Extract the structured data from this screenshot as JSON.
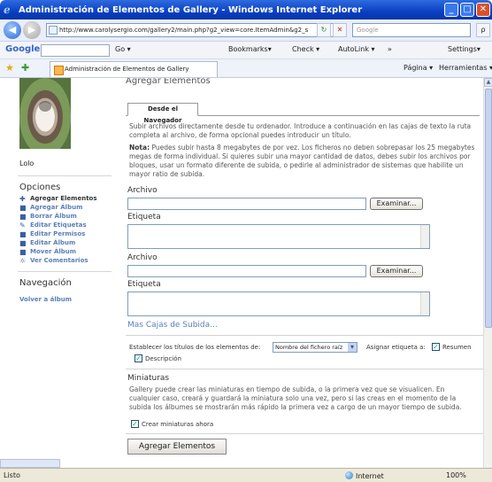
{
  "window": {
    "title": "Administración de Elementos de Gallery - Windows Internet Explorer",
    "minimize": "_",
    "maximize": "□",
    "close": "✕"
  },
  "navbar": {
    "back": "◀",
    "forward": "▶",
    "address": "http://www.carolysergio.com/gallery2/main.php?g2_view=core.ItemAdmin&g2_s",
    "refresh": "↻",
    "stop": "✕",
    "search_placeholder": "Google",
    "search_go": "ρ"
  },
  "google_toolbar": {
    "logo": "Google",
    "logo_arrow": "G▾",
    "go": "Go ▾",
    "bookmarks": "Bookmarks▾",
    "check": "Check ▾",
    "autolink": "AutoLink ▾",
    "more": "»",
    "settings": "Settings▾"
  },
  "tabbar": {
    "tab_title": "Administración de Elementos de Gallery",
    "page_menu": "Página ▾",
    "tools_menu": "Herramientas ▾"
  },
  "sidebar": {
    "username": "Lolo",
    "options_heading": "Opciones",
    "items": [
      {
        "label": "Agregar Elementos",
        "active": true,
        "icon": "add-items-icon"
      },
      {
        "label": "Agregar Álbum",
        "active": false,
        "icon": "add-album-icon"
      },
      {
        "label": "Borrar Álbum",
        "active": false,
        "icon": "delete-album-icon"
      },
      {
        "label": "Editar Etiquetas",
        "active": false,
        "icon": "tags-icon"
      },
      {
        "label": "Editar Permisos",
        "active": false,
        "icon": "permissions-icon"
      },
      {
        "label": "Editar Álbum",
        "active": false,
        "icon": "edit-album-icon"
      },
      {
        "label": "Mover Álbum",
        "active": false,
        "icon": "move-album-icon"
      },
      {
        "label": "Ver Comentarios",
        "active": false,
        "icon": "comments-icon"
      }
    ],
    "nav_heading": "Navegación",
    "back_link": "Volver a álbum"
  },
  "main": {
    "title": "Agregar Elementos",
    "subtab": "Desde el Navegador",
    "intro": "Subir archivos directamente desde tu ordenador. Introduce a continuación en las cajas de texto la ruta completa al archivo, de forma opcional puedes introducir un título.",
    "note_label": "Nota:",
    "note": " Puedes subir hasta 8 megabytes de por vez. Los ficheros no deben sobrepasar los 25 megabytes megas de forma individual. Si quieres subir una mayor cantidad de datos, debes subir los archivos por bloques, usar un formato diferente de subida, o pedirle al administrador de sistemas que habilite un mayor ratio de subida.",
    "file_label": "Archivo",
    "caption_label": "Etiqueta",
    "browse_button": "Examinar...",
    "more_boxes_link": "Mas Cajas de Subida...",
    "title_setting_label": "Establecer los títulos de los elementos de:",
    "title_setting_value": "Nombre del fichero raíz",
    "assign_label": "Asignar etiqueta a:",
    "summary_label": "Resumen",
    "description_label": "Descripción",
    "thumbnails_heading": "Miniaturas",
    "thumbnails_text": "Gallery puede crear las miniaturas en tiempo de subida, o la primera vez que se visualicen. En cualquier caso, creará y guardará la miniatura solo una vez, pero si las creas en el momento de la subida los álbumes se mostrarán más rápido la primera vez a cargo de un mayor tiempo de subida.",
    "create_now_label": "Crear miniaturas ahora",
    "submit_button": "Agregar Elementos"
  },
  "statusbar": {
    "status": "Listo",
    "zone": "Internet",
    "zoom": "100%"
  }
}
